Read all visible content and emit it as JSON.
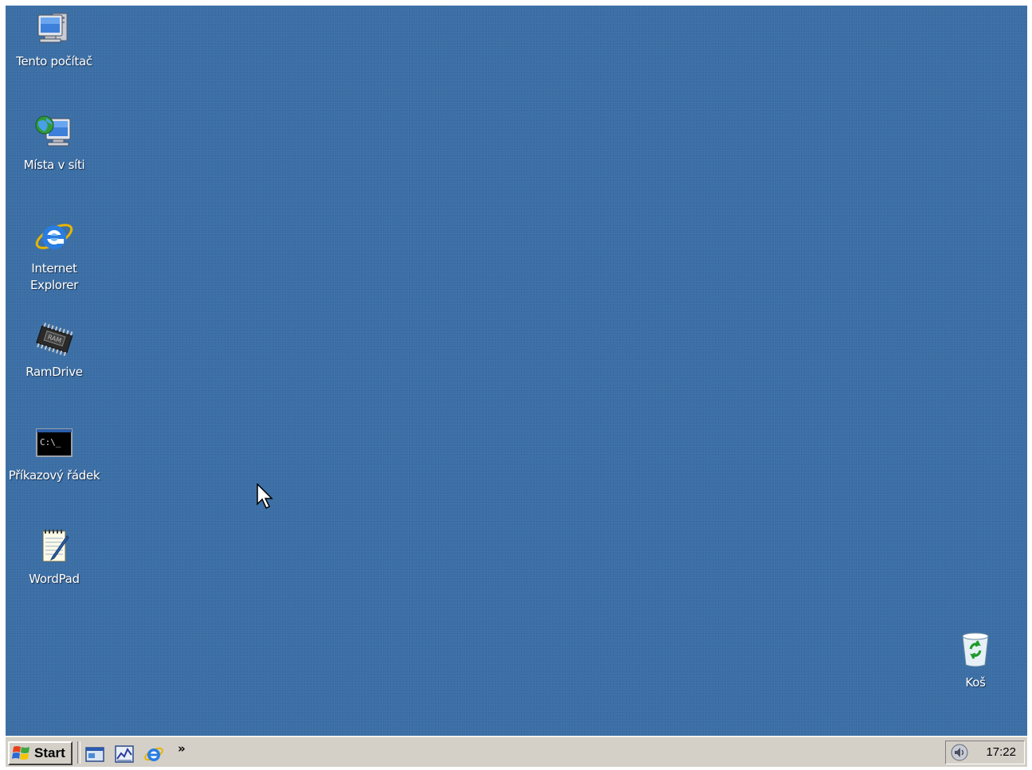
{
  "desktop": {
    "background_color": "#3a6ea5",
    "icons": [
      {
        "label": "Tento počítač",
        "icon": "my-computer-icon"
      },
      {
        "label": "Místa v síti",
        "icon": "network-places-icon"
      },
      {
        "label": "Internet Explorer",
        "icon": "internet-explorer-icon"
      },
      {
        "label": "RamDrive",
        "icon": "ram-chip-icon"
      },
      {
        "label": "Příkazový řádek",
        "icon": "command-prompt-icon"
      },
      {
        "label": "WordPad",
        "icon": "wordpad-icon"
      },
      {
        "label": "Koš",
        "icon": "recycle-bin-icon"
      }
    ],
    "cmd_icon_text": "C:\\_"
  },
  "taskbar": {
    "start_label": "Start",
    "quick_launch": [
      {
        "icon": "show-desktop-icon"
      },
      {
        "icon": "performance-chart-icon"
      },
      {
        "icon": "internet-explorer-icon"
      }
    ],
    "more_label": "»",
    "clock": "17:22",
    "tray_icon": "volume-icon"
  }
}
